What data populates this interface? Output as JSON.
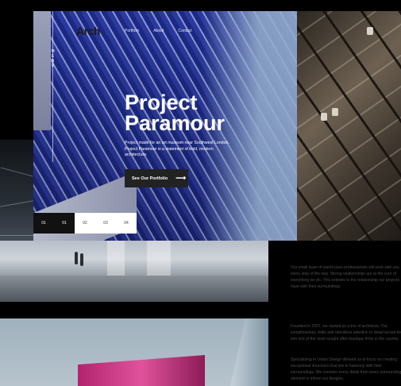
{
  "brand": {
    "logo": "Arch"
  },
  "side_menu": {
    "label": "MENU"
  },
  "nav": {
    "items": [
      "Portfolio",
      "About",
      "Contact"
    ]
  },
  "hero": {
    "title_line1": "Project",
    "title_line2": "Paramour",
    "description": "Project made for an art museum near Southwest London. Project Paramour is a statement of bold, modern architecture.",
    "cta_label": "See Our Portfolio",
    "cta_icon": "arrow-right-icon"
  },
  "slides": {
    "current": "01",
    "items": [
      "01",
      "02",
      "03",
      "04"
    ]
  },
  "about": {
    "para1": "Our small team of world-class professionals will work with you every step of the way. Strong relationships are at the core of everything we do. This extends to the relationship our projects have with their surroundings.",
    "para2": "Founded in 2007, we started as a trio of architects. Our complimentary skills and relentless attention to detail turned Arch into one of the most sought after boutique firms in the country.",
    "para3": "Specializing in Urban Design allowed us to focus on creating exceptional structures that live in harmony with their surroundings. We consider every detail from every surrounding element to inform our designs."
  },
  "colors": {
    "background": "#000000",
    "button": "#222222",
    "slide_active": "#ffffff"
  }
}
